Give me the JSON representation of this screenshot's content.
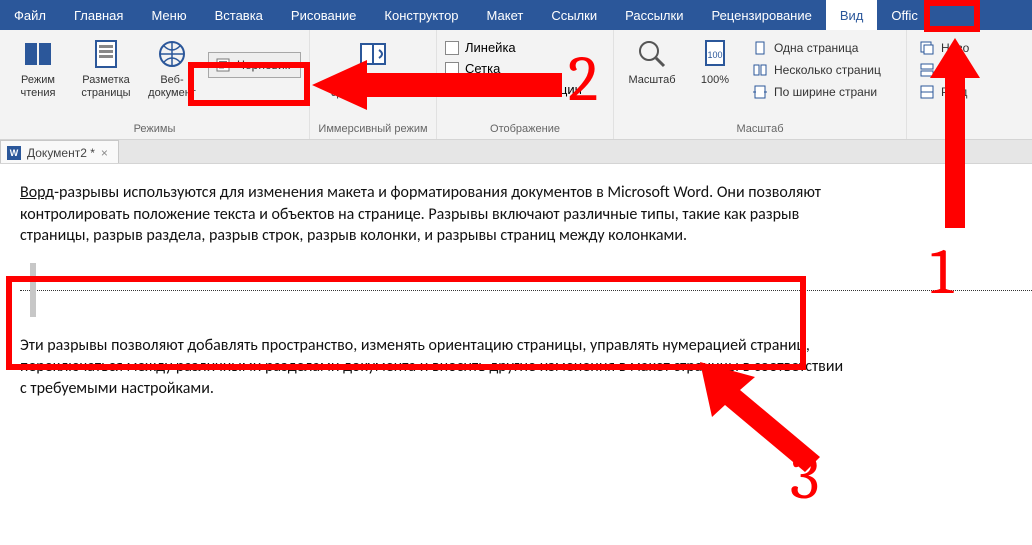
{
  "menu": {
    "items": [
      "Файл",
      "Главная",
      "Меню",
      "Вставка",
      "Рисование",
      "Конструктор",
      "Макет",
      "Ссылки",
      "Рассылки",
      "Рецензирование",
      "Вид",
      "Offic"
    ],
    "active_index": 10
  },
  "ribbon": {
    "groups": {
      "modes": {
        "label": "Режимы",
        "reading_mode": "Режим чтения",
        "page_layout": "Разметка страницы",
        "web_doc": "Веб-документ",
        "draft": "Черновик"
      },
      "immersive": {
        "label": "Иммерсивный режим",
        "immersive_reader": "Иммерсивное средство чтения"
      },
      "show": {
        "label": "Отображение",
        "ruler": "Линейка",
        "gridlines": "Сетка",
        "nav_pane": "Область навигации"
      },
      "zoom": {
        "label": "Масштаб",
        "zoom": "Масштаб",
        "hundred": "100%",
        "one_page": "Одна страница",
        "multi_page": "Несколько страниц",
        "page_width": "По ширине страни"
      },
      "window_extra": {
        "new_window": "Ново",
        "arrange": "Упор",
        "split": "Разд"
      }
    }
  },
  "doc_tab": {
    "title": "Документ2 *",
    "icon_letter": "W"
  },
  "document": {
    "para1_underlined": "Ворд",
    "para1_rest": "-разрывы используются для изменения макета и форматирования документов в Microsoft Word. Они позволяют контролировать положение текста и объектов на странице. Разрывы включают различные типы, такие как разрыв страницы, разрыв раздела, разрыв строк, разрыв колонки, и разрывы страниц между колонками.",
    "para2": "Эти разрывы позволяют добавлять пространство, изменять ориентацию страницы, управлять нумерацией страниц, переключаться между различными разделами документа и вносить другие изменения в макет страницы в соответствии с требуемыми настройками."
  },
  "annotations": {
    "n1": "1",
    "n2": "2",
    "n3": "3"
  }
}
